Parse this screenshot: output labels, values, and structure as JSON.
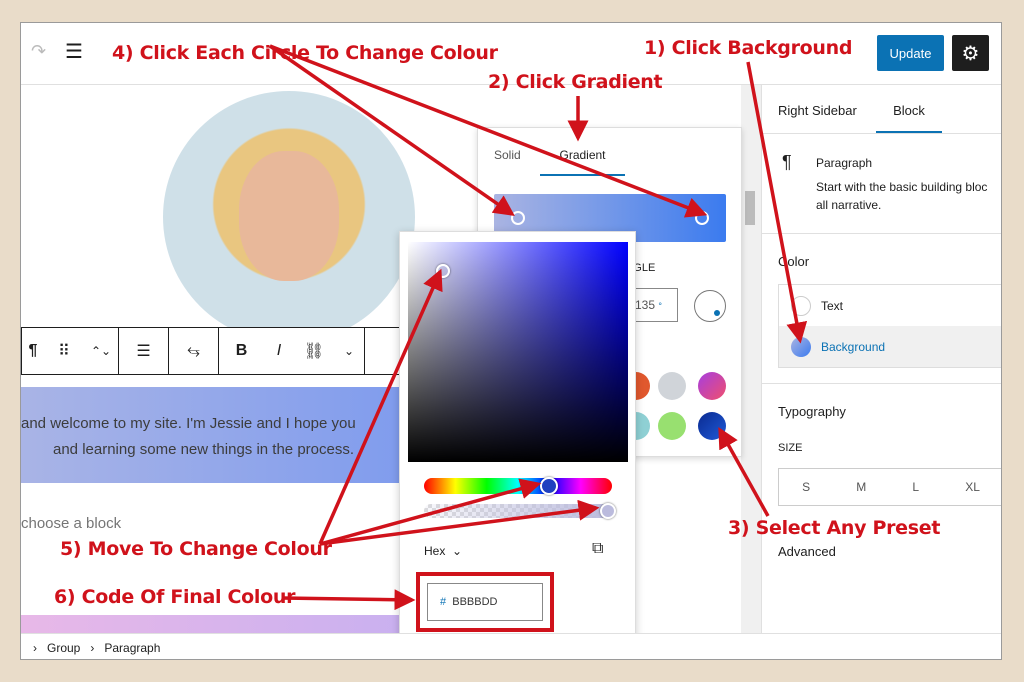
{
  "topbar": {
    "update_label": "Update",
    "redo_icon": "redo-icon",
    "list_view_icon": "list-view-icon",
    "settings_icon": "gear-icon"
  },
  "block_toolbar": {
    "paragraph": "¶",
    "bold": "B",
    "italic": "I"
  },
  "content": {
    "line1": "and welcome to my site. I'm Jessie and I hope you",
    "line2": "and learning some new things in the process.",
    "choose_block": "choose a block"
  },
  "gradient_panel": {
    "tabs": [
      "Solid",
      "Gradient"
    ],
    "active_tab": "Gradient",
    "angle_label": "ANGLE",
    "angle_value": "135",
    "angle_unit": "°",
    "gradient_colors": [
      "#aab4e2",
      "#3b7bef"
    ]
  },
  "picker": {
    "format": "Hex",
    "hash": "#",
    "hex_value": "BBBBDD",
    "selected_color": "#bbbbdd"
  },
  "sidebar": {
    "tabs": [
      "Right Sidebar",
      "Block"
    ],
    "active_tab": "Block",
    "block_name": "Paragraph",
    "block_desc1": "Start with the basic building bloc",
    "block_desc2": "all narrative.",
    "color_heading": "Color",
    "color_items": [
      "Text",
      "Background"
    ],
    "typography": "Typography",
    "size_label": "SIZE",
    "sizes": [
      "S",
      "M",
      "L",
      "XL"
    ],
    "advanced": "Advanced"
  },
  "breadcrumb": [
    "Group",
    "Paragraph"
  ],
  "annotations": [
    "1) Click Background",
    "2) Click Gradient",
    "3) Select Any Preset",
    "4) Click Each Circle To Change Colour",
    "5) Move To Change Colour",
    "6) Code Of Final Colour"
  ],
  "colors": {
    "annotation": "#d0121b",
    "accent": "#0b72b4",
    "background": "#e9dcc9"
  }
}
